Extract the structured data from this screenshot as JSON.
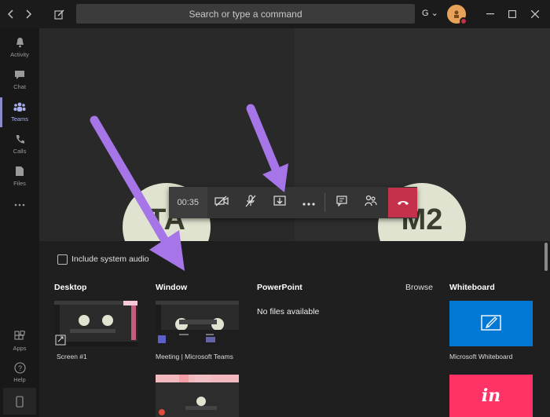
{
  "titlebar": {
    "search_placeholder": "Search or type a command",
    "org_initial": "G",
    "icons": [
      "back-icon",
      "forward-icon",
      "compose-icon",
      "minimize-icon",
      "maximize-icon",
      "close-icon"
    ]
  },
  "rail": {
    "items": [
      {
        "label": "Activity",
        "icon": "bell-icon"
      },
      {
        "label": "Chat",
        "icon": "chat-icon"
      },
      {
        "label": "Teams",
        "icon": "teams-icon",
        "active": true
      },
      {
        "label": "Calls",
        "icon": "phone-icon"
      },
      {
        "label": "Files",
        "icon": "file-icon"
      },
      {
        "label": "",
        "icon": "more-icon"
      }
    ],
    "bottom": [
      {
        "label": "Apps",
        "icon": "apps-icon"
      },
      {
        "label": "Help",
        "icon": "help-icon"
      },
      {
        "label": "",
        "icon": "device-icon"
      }
    ]
  },
  "stage": {
    "participants": [
      "TA",
      "M2"
    ]
  },
  "callbar": {
    "timer": "00:35",
    "buttons": [
      "camera-off-icon",
      "mic-off-icon",
      "share-tray-icon",
      "more-icon",
      "chat-icon",
      "participants-icon",
      "hangup-icon"
    ]
  },
  "tray": {
    "include_audio": "Include system audio",
    "sections": {
      "desktop": {
        "title": "Desktop",
        "item": "Screen #1"
      },
      "window": {
        "title": "Window",
        "item": "Meeting | Microsoft Teams"
      },
      "powerpoint": {
        "title": "PowerPoint",
        "browse": "Browse",
        "empty": "No files available"
      },
      "whiteboard": {
        "title": "Whiteboard",
        "item": "Microsoft Whiteboard",
        "invision": "in"
      }
    }
  },
  "colors": {
    "accent": "#8b8cc7",
    "hangup": "#c4314b",
    "whiteboard": "#0078d4",
    "invision": "#ff3366",
    "arrow": "#a675e8"
  }
}
